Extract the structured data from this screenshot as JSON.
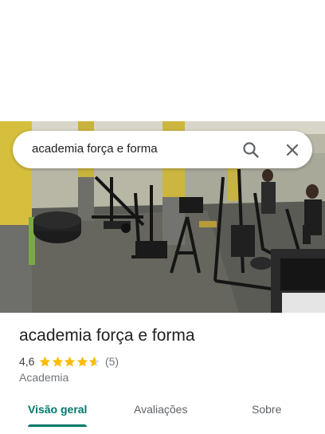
{
  "search": {
    "query": "academia força e forma"
  },
  "place": {
    "name": "academia força e forma",
    "rating": "4,6",
    "rating_stars": 4.6,
    "reviews": "(5)",
    "category": "Academia"
  },
  "tabs": [
    {
      "label": "Visão geral",
      "active": true
    },
    {
      "label": "Avaliações",
      "active": false
    },
    {
      "label": "Sobre",
      "active": false
    }
  ],
  "colors": {
    "accent": "#00796b",
    "star": "#fbbc04",
    "star_empty": "#dadce0"
  },
  "icons": {
    "search": "search-icon",
    "close": "close-icon",
    "star": "star-icon"
  }
}
